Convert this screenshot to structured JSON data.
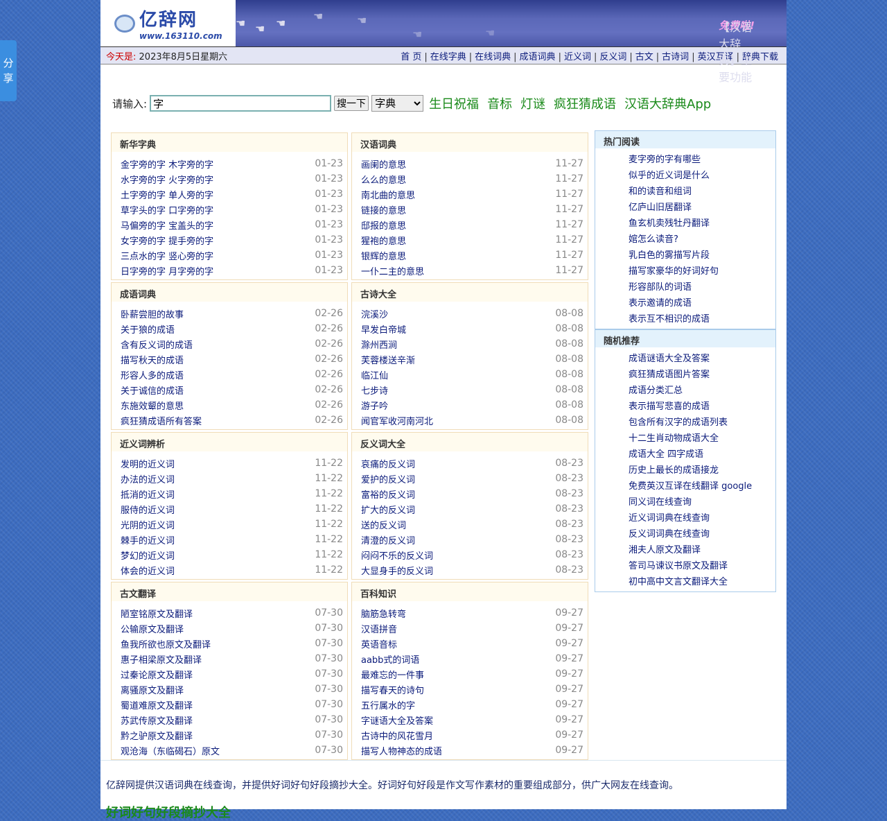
{
  "share": {
    "label1": "分",
    "label2": "享"
  },
  "header": {
    "logo_title": "亿辞网",
    "logo_url": "www.163110.com",
    "promo_text": "【汉语大辞典】主要功能",
    "promo_highlight": "免费啦!"
  },
  "navbar": {
    "today_label": "今天是:",
    "date": "2023年8月5日星期六",
    "links": [
      "首 页",
      "在线字典",
      "在线词典",
      "成语词典",
      "近义词",
      "反义词",
      "古文",
      "古诗词",
      "英汉互译",
      "辞典下载"
    ]
  },
  "search": {
    "label": "请输入:",
    "value": "字",
    "button": "搜一下",
    "select": "字典",
    "links": [
      "生日祝福",
      "音标",
      "灯谜",
      "疯狂猜成语",
      "汉语大辞典App"
    ]
  },
  "panels": [
    {
      "title": "新华字典",
      "items": [
        [
          "金字旁的字 木字旁的字",
          "01-23"
        ],
        [
          "水字旁的字 火字旁的字",
          "01-23"
        ],
        [
          "土字旁的字 单人旁的字",
          "01-23"
        ],
        [
          "草字头的字 口字旁的字",
          "01-23"
        ],
        [
          "马偏旁的字 宝盖头的字",
          "01-23"
        ],
        [
          "女字旁的字 提手旁的字",
          "01-23"
        ],
        [
          "三点水的字 竖心旁的字",
          "01-23"
        ],
        [
          "日字旁的字 月字旁的字",
          "01-23"
        ]
      ]
    },
    {
      "title": "汉语词典",
      "items": [
        [
          "画阑的意思",
          "11-27"
        ],
        [
          "么么的意思",
          "11-27"
        ],
        [
          "南北曲的意思",
          "11-27"
        ],
        [
          "链接的意思",
          "11-27"
        ],
        [
          "邸报的意思",
          "11-27"
        ],
        [
          "猩袍的意思",
          "11-27"
        ],
        [
          "银辉的意思",
          "11-27"
        ],
        [
          "一仆二主的意思",
          "11-27"
        ]
      ]
    },
    {
      "title": "成语词典",
      "items": [
        [
          "卧薪尝胆的故事",
          "02-26"
        ],
        [
          "关于狼的成语",
          "02-26"
        ],
        [
          "含有反义词的成语",
          "02-26"
        ],
        [
          "描写秋天的成语",
          "02-26"
        ],
        [
          "形容人多的成语",
          "02-26"
        ],
        [
          "关于诚信的成语",
          "02-26"
        ],
        [
          "东施效颦的意思",
          "02-26"
        ],
        [
          "疯狂猜成语所有答案",
          "02-26"
        ]
      ]
    },
    {
      "title": "古诗大全",
      "items": [
        [
          "浣溪沙",
          "08-08"
        ],
        [
          "早发白帝城",
          "08-08"
        ],
        [
          "滁州西涧",
          "08-08"
        ],
        [
          "芙蓉楼送辛渐",
          "08-08"
        ],
        [
          "临江仙",
          "08-08"
        ],
        [
          "七步诗",
          "08-08"
        ],
        [
          "游子吟",
          "08-08"
        ],
        [
          "闻官军收河南河北",
          "08-08"
        ]
      ]
    },
    {
      "title": "近义词辨析",
      "items": [
        [
          "发明的近义词",
          "11-22"
        ],
        [
          "办法的近义词",
          "11-22"
        ],
        [
          "抵消的近义词",
          "11-22"
        ],
        [
          "服侍的近义词",
          "11-22"
        ],
        [
          "光阴的近义词",
          "11-22"
        ],
        [
          "棘手的近义词",
          "11-22"
        ],
        [
          "梦幻的近义词",
          "11-22"
        ],
        [
          "体会的近义词",
          "11-22"
        ]
      ]
    },
    {
      "title": "反义词大全",
      "items": [
        [
          "哀痛的反义词",
          "08-23"
        ],
        [
          "爱护的反义词",
          "08-23"
        ],
        [
          "富裕的反义词",
          "08-23"
        ],
        [
          "扩大的反义词",
          "08-23"
        ],
        [
          "送的反义词",
          "08-23"
        ],
        [
          "清澄的反义词",
          "08-23"
        ],
        [
          "闷闷不乐的反义词",
          "08-23"
        ],
        [
          "大显身手的反义词",
          "08-23"
        ]
      ]
    },
    {
      "title": "古文翻译",
      "items": [
        [
          "陋室铭原文及翻译",
          "07-30"
        ],
        [
          "公输原文及翻译",
          "07-30"
        ],
        [
          "鱼我所欲也原文及翻译",
          "07-30"
        ],
        [
          "惠子相梁原文及翻译",
          "07-30"
        ],
        [
          "过秦论原文及翻译",
          "07-30"
        ],
        [
          "离骚原文及翻译",
          "07-30"
        ],
        [
          "蜀道难原文及翻译",
          "07-30"
        ],
        [
          "苏武传原文及翻译",
          "07-30"
        ],
        [
          "黔之驴原文及翻译",
          "07-30"
        ],
        [
          "观沧海（东临碣石）原文",
          "07-30"
        ]
      ]
    },
    {
      "title": "百科知识",
      "items": [
        [
          "脑筋急转弯",
          "09-27"
        ],
        [
          "汉语拼音",
          "09-27"
        ],
        [
          "英语音标",
          "09-27"
        ],
        [
          "aabb式的词语",
          "09-27"
        ],
        [
          "最难忘的一件事",
          "09-27"
        ],
        [
          "描写春天的诗句",
          "09-27"
        ],
        [
          "五行属水的字",
          "09-27"
        ],
        [
          "字谜语大全及答案",
          "09-27"
        ],
        [
          "古诗中的风花雪月",
          "09-27"
        ],
        [
          "描写人物神态的成语",
          "09-27"
        ]
      ]
    }
  ],
  "sidebar": [
    {
      "title": "热门阅读",
      "items": [
        "麦字旁的字有哪些",
        "似乎的近义词是什么",
        "和的读音和组词",
        "亿庐山旧居翻译",
        "鱼玄机卖残牡丹翻译",
        "婠怎么读音?",
        "乳白色的雾描写片段",
        "描写家豪华的好词好句",
        "形容部队的词语",
        "表示邀请的成语",
        "表示互不相识的成语"
      ]
    },
    {
      "title": "随机推荐",
      "items": [
        "成语谜语大全及答案",
        "疯狂猜成语图片答案",
        "成语分类汇总",
        "表示描写悲喜的成语",
        "包含所有汉字的成语列表",
        "十二生肖动物成语大全",
        "成语大全 四字成语",
        "历史上最长的成语接龙",
        "免费英汉互译在线翻译 google",
        "同义词在线查询",
        "近义词词典在线查询",
        "反义词词典在线查询",
        "湘夫人原文及翻译",
        "答司马谏议书原文及翻译",
        "初中高中文言文翻译大全"
      ]
    }
  ],
  "intro": {
    "text": "亿辞网提供汉语词典在线查询，并提供好词好句好段摘抄大全。好词好句好段是作文写作素材的重要组成部分，供广大网友在线查询。",
    "heading": "好词好句好段摘抄大全"
  }
}
